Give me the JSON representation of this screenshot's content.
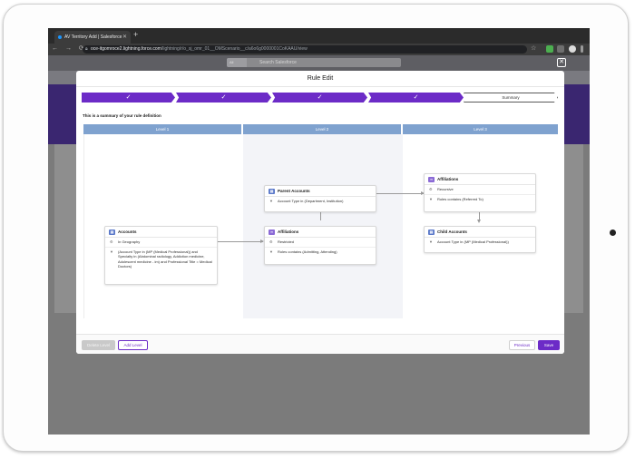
{
  "browser": {
    "tab_title": "AV Territory Add | Salesforce",
    "url_host": "oce-itgomroce2.lightning.force.com",
    "url_path": "/lightning/r/o_sj_omr_01__OMScenario__c/a6o6g0000001CoKAAU/view"
  },
  "salesforce": {
    "search_scope": "All",
    "search_placeholder": "Search Salesforce"
  },
  "modal": {
    "title": "Rule Edit",
    "close_label": "✕",
    "steps": [
      {
        "label": "✓"
      },
      {
        "label": "✓"
      },
      {
        "label": "✓"
      },
      {
        "label": "✓"
      },
      {
        "label": "Summary"
      }
    ],
    "summary_text": "This is a summary of your rule definition",
    "levels": [
      "Level 1",
      "Level 2",
      "Level 3"
    ],
    "nodes": {
      "accounts": {
        "title": "Accounts",
        "rows": [
          "In Geography",
          "(Account Type in (MP (Medical Professional)) and Specialty in (Abdominal radiology, Addiction medicine, Adolescent medicine - im) and Professional Title = Medical Doctors)"
        ]
      },
      "parent_accounts": {
        "title": "Parent Accounts",
        "rows": [
          "Account Type in (Department, Institution)"
        ]
      },
      "affiliations_l2": {
        "title": "Affiliations",
        "rows": [
          "Restricted",
          "Roles contains (Admitting, Attending)"
        ]
      },
      "affiliations_l3": {
        "title": "Affiliations",
        "rows": [
          "Recursive",
          "Roles contains (Referred To)"
        ]
      },
      "child_accounts": {
        "title": "Child Accounts",
        "rows": [
          "Account Type in (MP (Medical Professional))"
        ]
      }
    },
    "footer": {
      "delete_label": "Delete Level",
      "add_label": "Add Level",
      "previous_label": "Previous",
      "save_label": "Save"
    }
  },
  "colors": {
    "accent": "#6c2bc7",
    "level_header": "#7fa2cf"
  }
}
